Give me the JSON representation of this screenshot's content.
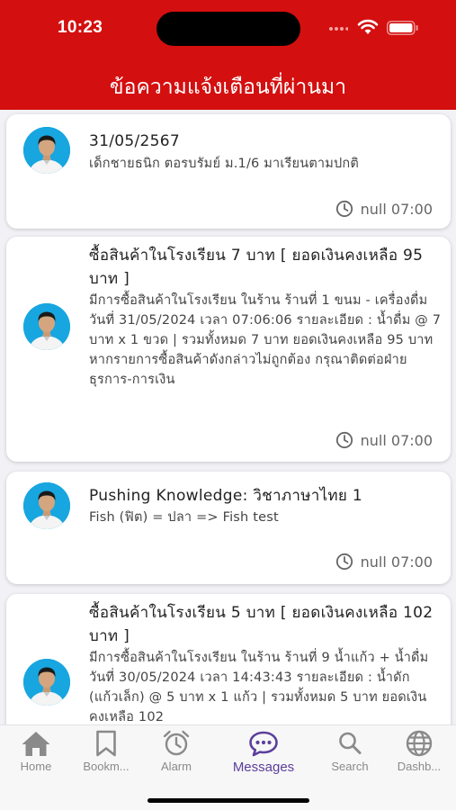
{
  "status": {
    "time": "10:23"
  },
  "header": {
    "title": "ข้อความแจ้งเตือนที่ผ่านมา"
  },
  "notifications": [
    {
      "title": "31/05/2567",
      "body": "เด็กชายธนิก ตอรบรัมย์ ม.1/6 มาเรียนตามปกติ",
      "time": "null 07:00"
    },
    {
      "title": "ซื้อสินค้าในโรงเรียน 7 บาท   [ ยอดเงินคงเหลือ 95 บาท  ]",
      "body": "มีการซื้อสินค้าในโรงเรียน ในร้าน  ร้านที่ 1 ขนม - เครื่องดื่ม  วันที่ 31/05/2024 เวลา 07:06:06 รายละเอียด : น้ำดื่ม  @ 7 บาท x  1  ขวด  | รวมทั้งหมด 7  บาท ยอดเงินคงเหลือ 95 บาท หากรายการซื้อสินค้าดังกล่าวไม่ถูกต้อง กรุณาติดต่อฝ่ายธุรการ-การเงิน",
      "time": "null 07:00"
    },
    {
      "title": "Pushing Knowledge: วิชาภาษาไทย 1",
      "body": "Fish (ฟิต) = ปลา => Fish test",
      "time": "null 07:00"
    },
    {
      "title": "ซื้อสินค้าในโรงเรียน 5 บาท   [ ยอดเงินคงเหลือ 102 บาท  ]",
      "body": "มีการซื้อสินค้าในโรงเรียน ในร้าน  ร้านที่ 9 น้ำแก้ว + น้ำดื่ม วันที่ 30/05/2024 เวลา 14:43:43 รายละเอียด : น้ำดัก (แก้วเล็ก)  @ 5 บาท x  1  แก้ว  | รวมทั้งหมด 5  บาท ยอดเงินคงเหลือ 102",
      "time": ""
    }
  ],
  "tabs": [
    {
      "label": "Home",
      "icon": "home-icon"
    },
    {
      "label": "Bookm...",
      "icon": "bookmark-icon"
    },
    {
      "label": "Alarm",
      "icon": "alarm-icon"
    },
    {
      "label": "Messages",
      "icon": "message-icon",
      "active": true
    },
    {
      "label": "Search",
      "icon": "search-icon"
    },
    {
      "label": "Dashb...",
      "icon": "globe-icon"
    }
  ],
  "colors": {
    "header": "#d40f0f",
    "active_tab": "#5b3f9b",
    "inactive_tab": "#8a8a8a"
  }
}
